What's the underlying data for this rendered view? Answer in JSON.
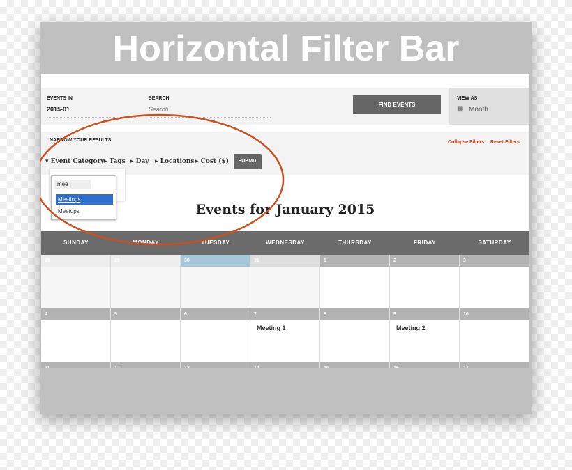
{
  "banner": {
    "title": "Horizontal Filter Bar"
  },
  "search_bar": {
    "events_in_label": "EVENTS IN",
    "events_in_value": "2015-01",
    "search_label": "SEARCH",
    "search_placeholder": "Search",
    "find_button": "FIND EVENTS",
    "view_as_label": "VIEW AS",
    "view_as_value": "Month"
  },
  "filters": {
    "heading": "NARROW YOUR RESULTS",
    "collapse": "Collapse Filters",
    "reset": "Reset Filters",
    "items": [
      {
        "label": "Event Category",
        "expanded": true
      },
      {
        "label": "Tags"
      },
      {
        "label": "Day"
      },
      {
        "label": "Locations"
      },
      {
        "label": "Cost ($)"
      }
    ],
    "submit": "SUBMIT",
    "dropdown": {
      "query": "mee",
      "options": [
        {
          "label": "Meetings",
          "selected": true
        },
        {
          "label": "Meetups"
        }
      ]
    }
  },
  "calendar": {
    "title": "Events for January 2015",
    "days": [
      "SUNDAY",
      "MONDAY",
      "TUESDAY",
      "WEDNESDAY",
      "THURSDAY",
      "FRIDAY",
      "SATURDAY"
    ],
    "weeks": [
      [
        {
          "d": "28",
          "other": true
        },
        {
          "d": "29",
          "other": true
        },
        {
          "d": "30",
          "other": true,
          "today": true
        },
        {
          "d": "31",
          "other": true
        },
        {
          "d": "1"
        },
        {
          "d": "2"
        },
        {
          "d": "3"
        }
      ],
      [
        {
          "d": "4"
        },
        {
          "d": "5"
        },
        {
          "d": "6"
        },
        {
          "d": "7",
          "event": "Meeting 1"
        },
        {
          "d": "8"
        },
        {
          "d": "9",
          "event": "Meeting 2"
        },
        {
          "d": "10"
        }
      ],
      [
        {
          "d": "11"
        },
        {
          "d": "12"
        },
        {
          "d": "13"
        },
        {
          "d": "14"
        },
        {
          "d": "15"
        },
        {
          "d": "16"
        },
        {
          "d": "17"
        }
      ]
    ]
  },
  "colors": {
    "accent": "#c8401a",
    "header": "#6b6b6b",
    "today": "#a5c8d8",
    "selected": "#2f6fd0"
  }
}
